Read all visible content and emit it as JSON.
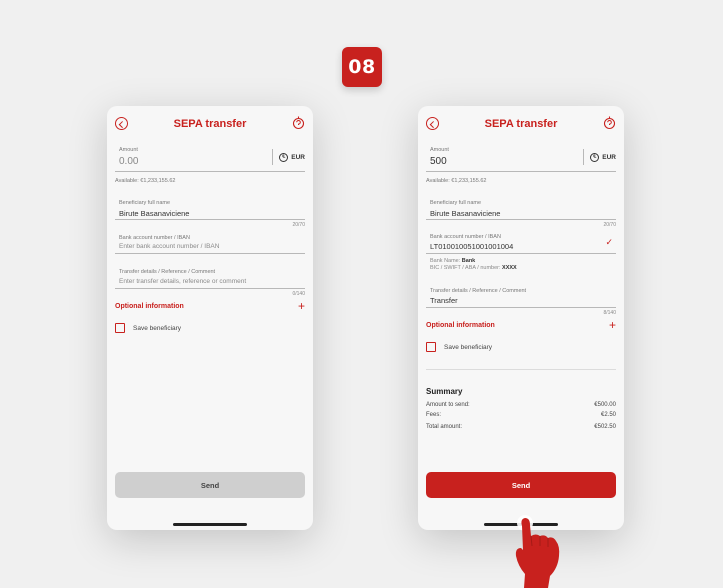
{
  "step": "08",
  "left": {
    "title": "SEPA transfer",
    "amount_label": "Amount",
    "amount_value": "0.00",
    "currency": "EUR",
    "available": "Available: €1,233,155.62",
    "beneficiary_label": "Beneficiary full name",
    "beneficiary_value": "Birute Basanaviciene",
    "beneficiary_counter": "20/70",
    "iban_label": "Bank account number / IBAN",
    "iban_placeholder": "Enter bank account number / IBAN",
    "details_label": "Transfer details / Reference / Comment",
    "details_placeholder": "Enter transfer details, reference or comment",
    "details_counter": "0/140",
    "optional_label": "Optional information",
    "save_label": "Save beneficiary",
    "send_label": "Send"
  },
  "right": {
    "title": "SEPA transfer",
    "amount_label": "Amount",
    "amount_value": "500",
    "currency": "EUR",
    "available": "Available: €1,233,155.62",
    "beneficiary_label": "Beneficiary full name",
    "beneficiary_value": "Birute Basanaviciene",
    "beneficiary_counter": "20/70",
    "iban_label": "Bank account number / IBAN",
    "iban_value": "LT010010051001001004",
    "bank_name_label": "Bank Name:",
    "bank_name_value": "Bank",
    "bic_label": "BIC / SWIFT / ABA / number:",
    "bic_value": "XXXX",
    "details_label": "Transfer details / Reference / Comment",
    "details_value": "Transfer",
    "details_counter": "8/140",
    "optional_label": "Optional information",
    "save_label": "Save beneficiary",
    "summary_title": "Summary",
    "summary_rows": [
      {
        "label": "Amount to send:",
        "value": "€500.00"
      },
      {
        "label": "Fees:",
        "value": "€2.50"
      },
      {
        "label": "Total amount:",
        "value": "€502.50"
      }
    ],
    "send_label": "Send"
  },
  "colors": {
    "accent": "#c8211e",
    "disabled": "#cfcfcf",
    "background": "#f0f0f0"
  },
  "icons": [
    "back-icon",
    "help-icon",
    "euro-icon",
    "plus-icon",
    "check-icon",
    "hand-pointer-icon"
  ]
}
